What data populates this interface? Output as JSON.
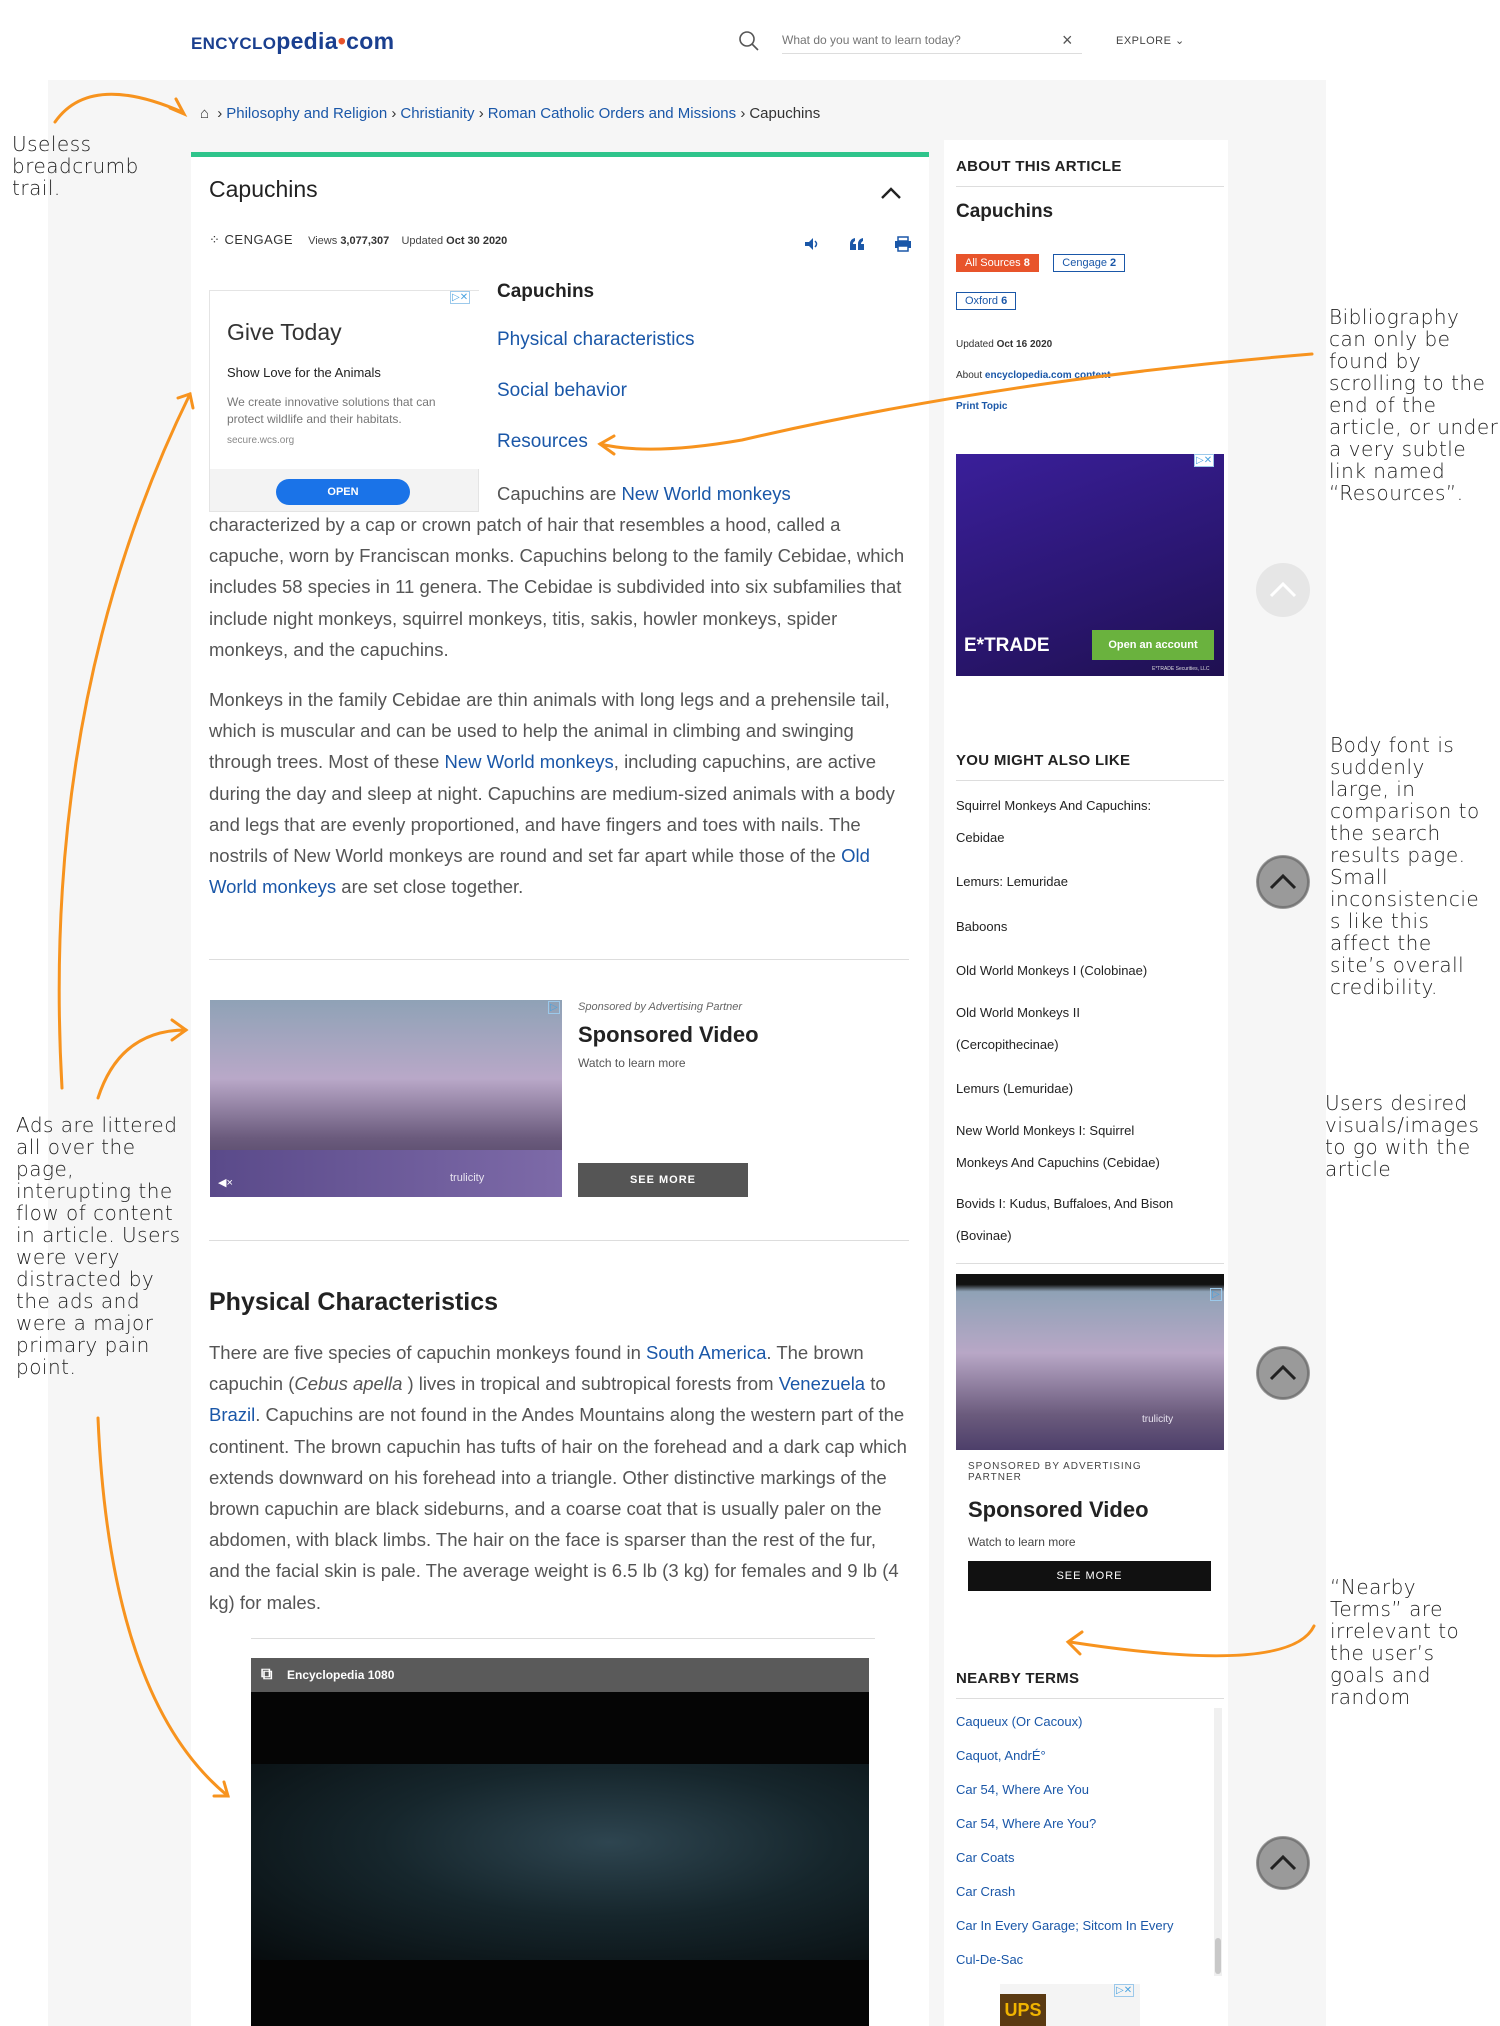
{
  "header": {
    "logo_prefix": "ENCYCLO",
    "logo_mid": "pedia",
    "logo_dot": "•",
    "logo_suffix": "com",
    "search_placeholder": "What do you want to learn today?",
    "explore_label": "EXPLORE"
  },
  "breadcrumb": [
    "Philosophy and Religion",
    "Christianity",
    "Roman Catholic Orders and Missions",
    "Capuchins"
  ],
  "article": {
    "title": "Capuchins",
    "publisher": "CENGAGE",
    "views_label": "Views",
    "views": "3,077,307",
    "updated_label": "Updated",
    "updated": "Oct 30 2020",
    "toc_title": "Capuchins",
    "toc": [
      "Physical characteristics",
      "Social behavior",
      "Resources"
    ],
    "p1_lead": "Capuchins are",
    "p1_link": "New World monkeys",
    "p1_line2": "characterized by a cap or crown patch of hair that resembles a hood, called a",
    "p1_rest": "capuche, worn by Franciscan monks. Capuchins belong to the family Cebidae, which includes 58 species in 11 genera. The Cebidae is subdivided into six subfamilies that include night monkeys, squirrel monkeys, titis, sakis, howler monkeys, spider monkeys, and the capuchins.",
    "p2_a": "Monkeys in the family Cebidae are thin animals with long legs and a prehensile tail, which is muscular and can be used to help the animal in climbing and swinging through trees. Most of these",
    "p2_link1": "New World monkeys",
    "p2_b": ", including capuchins, are active during the day and sleep at night. Capuchins are medium-sized animals with a body and legs that are evenly proportioned, and have fingers and toes with nails. The nostrils of New World monkeys are round and set far apart while those of the",
    "p2_link2": "Old World monkeys",
    "p2_c": "are set close together.",
    "h2": "Physical Characteristics",
    "p3_a": "There are five species of capuchin monkeys found in",
    "p3_link1": "South America",
    "p3_b": ". The brown capuchin (",
    "p3_italic": "Cebus apella",
    "p3_c": ") lives in tropical and subtropical forests from",
    "p3_link2": "Venezuela",
    "p3_d": "to",
    "p3_link3": "Brazil",
    "p3_e": ". Capuchins are not found in the Andes Mountains along the western part of the continent. The brown capuchin has tufts of hair on the forehead and a dark cap which extends downward on his forehead into a triangle. Other distinctive markings of the brown capuchin are black sideburns, and a coarse coat that is usually paler on the abdomen, with black limbs. The hair on the face is sparser than the rest of the fur, and the facial skin is pale. The average weight is 6.5 lb (3 kg) for females and 9 lb (4 kg) for males."
  },
  "ad_give": {
    "title": "Give Today",
    "subtitle": "Show Love for the Animals",
    "text": "We create innovative solutions that can protect wildlife and their habitats.",
    "url": "secure.wcs.org",
    "button": "OPEN"
  },
  "sponsored": {
    "by": "Sponsored by Advertising Partner",
    "title": "Sponsored Video",
    "sub": "Watch to learn more",
    "button": "SEE MORE",
    "brand": "trulicity"
  },
  "player": {
    "title": "Encyclopedia 1080"
  },
  "sidebar": {
    "about_heading": "ABOUT THIS ARTICLE",
    "about_title": "Capuchins",
    "badges": [
      {
        "label": "All Sources",
        "count": "8"
      },
      {
        "label": "Cengage",
        "count": "2"
      },
      {
        "label": "Oxford",
        "count": "6"
      }
    ],
    "updated_label": "Updated",
    "updated": "Oct 16 2020",
    "about_label": "About",
    "about_link": "encyclopedia.com content",
    "print_topic": "Print Topic",
    "etrade_logo": "E*TRADE",
    "etrade_button": "Open an account",
    "etrade_fine": "E*TRADE Securities, LLC",
    "like_heading": "YOU MIGHT ALSO LIKE",
    "like_items": [
      "Squirrel Monkeys And Capuchins: Cebidae",
      "Lemurs: Lemuridae",
      "Baboons",
      "Old World Monkeys I (Colobinae)",
      "Old World Monkeys II (Cercopithecinae)",
      "Lemurs (Lemuridae)",
      "New World Monkeys I: Squirrel Monkeys And Capuchins (Cebidae)",
      "Bovids I: Kudus, Buffaloes, And Bison (Bovinae)"
    ],
    "side_ad_by": "SPONSORED BY ADVERTISING PARTNER",
    "side_ad_title": "Sponsored Video",
    "side_ad_sub": "Watch to learn more",
    "side_ad_button": "SEE MORE",
    "nearby_heading": "NEARBY TERMS",
    "nearby": [
      "Caqueux (Or Cacoux)",
      "Caquot, AndrÉ°",
      "Car 54, Where Are You",
      "Car 54, Where Are You?",
      "Car Coats",
      "Car Crash",
      "Car In Every Garage; Sitcom In Every",
      "Cul-De-Sac"
    ],
    "ups_logo": "UPS"
  },
  "annotations": {
    "breadcrumb": "Useless breadcrumb trail.",
    "bibliography": "Bibliography can only be found by scrolling to the end of the article, or under a very subtle link named “Resources”.",
    "font": "Body font is suddenly large, in comparison to the search results page. Small inconsistencie s like this affect the site’s overall credibility.",
    "visuals": "Users desired visuals/images to go with the article",
    "ads": "Ads are littered all over the page, interupting the flow of content in article. Users were very distracted by the ads and were a major primary pain point.",
    "nearby": "“Nearby Terms” are irrelevant to the user’s goals and random"
  },
  "colors": {
    "accent": "#2ec48b",
    "link": "#1a57a8",
    "annotation": "#f7931e",
    "badge_red": "#e8542b"
  }
}
